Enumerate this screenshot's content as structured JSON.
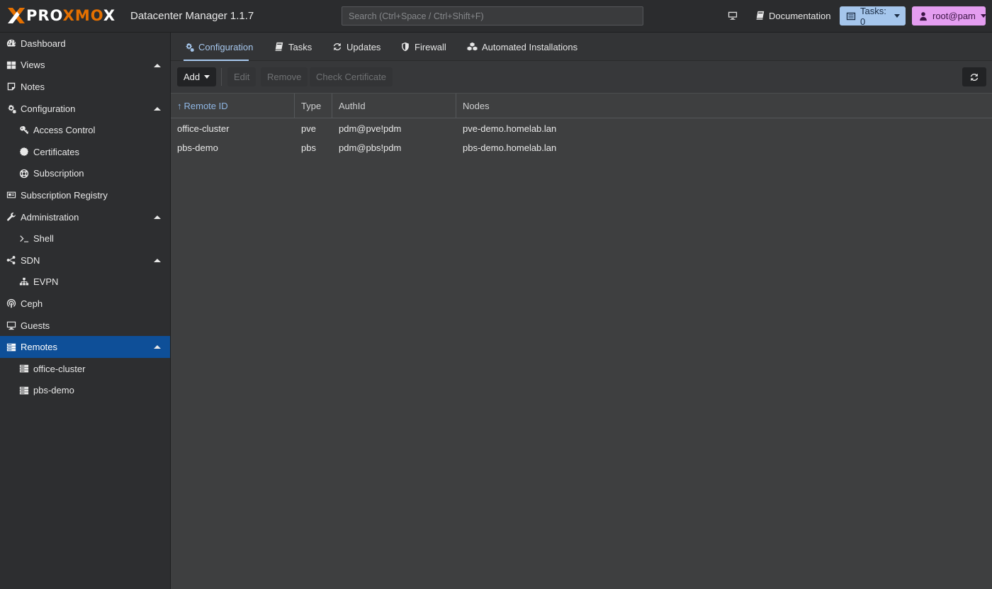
{
  "app": {
    "logo_prefix": "PRO",
    "logo_mid": "XMO",
    "logo_suffix": "X",
    "title": "Datacenter Manager 1.1.7"
  },
  "topbar": {
    "search_placeholder": "Search (Ctrl+Space / Ctrl+Shift+F)",
    "documentation_label": "Documentation",
    "tasks_label": "Tasks: 0",
    "user_label": "root@pam",
    "colors": {
      "tasks_bg": "#a5c6ec",
      "user_bg": "#e49df0",
      "brand_orange": "#e57000"
    }
  },
  "sidebar": {
    "items": [
      {
        "label": "Dashboard",
        "icon": "dashboard-icon"
      },
      {
        "label": "Views",
        "icon": "grid-icon",
        "expanded": true
      },
      {
        "label": "Notes",
        "icon": "note-icon"
      },
      {
        "label": "Configuration",
        "icon": "gears-icon",
        "expanded": true
      },
      {
        "label": "Access Control",
        "icon": "key-icon",
        "sub": true
      },
      {
        "label": "Certificates",
        "icon": "certificate-icon",
        "sub": true
      },
      {
        "label": "Subscription",
        "icon": "life-ring-icon",
        "sub": true
      },
      {
        "label": "Subscription Registry",
        "icon": "id-card-icon"
      },
      {
        "label": "Administration",
        "icon": "wrench-icon",
        "expanded": true
      },
      {
        "label": "Shell",
        "icon": "terminal-icon",
        "sub": true
      },
      {
        "label": "SDN",
        "icon": "network-icon",
        "expanded": true
      },
      {
        "label": "EVPN",
        "icon": "sitemap-icon",
        "sub": true
      },
      {
        "label": "Ceph",
        "icon": "ceph-icon"
      },
      {
        "label": "Guests",
        "icon": "desktop-icon"
      },
      {
        "label": "Remotes",
        "icon": "server-icon",
        "expanded": true,
        "active": true
      },
      {
        "label": "office-cluster",
        "icon": "server-icon",
        "sub": true
      },
      {
        "label": "pbs-demo",
        "icon": "server-icon",
        "sub": true
      }
    ]
  },
  "tabs": [
    {
      "label": "Configuration",
      "icon": "gears-icon",
      "active": true
    },
    {
      "label": "Tasks",
      "icon": "book-icon"
    },
    {
      "label": "Updates",
      "icon": "refresh-icon"
    },
    {
      "label": "Firewall",
      "icon": "shield-icon"
    },
    {
      "label": "Automated Installations",
      "icon": "cubes-icon"
    }
  ],
  "toolbar": {
    "add_label": "Add",
    "edit_label": "Edit",
    "remove_label": "Remove",
    "check_certificate_label": "Check Certificate"
  },
  "table": {
    "columns": [
      "Remote ID",
      "Type",
      "AuthId",
      "Nodes"
    ],
    "sorted_column": "Remote ID",
    "rows": [
      [
        "office-cluster",
        "pve",
        "pdm@pve!pdm",
        "pve-demo.homelab.lan"
      ],
      [
        "pbs-demo",
        "pbs",
        "pdm@pbs!pdm",
        "pbs-demo.homelab.lan"
      ]
    ]
  }
}
